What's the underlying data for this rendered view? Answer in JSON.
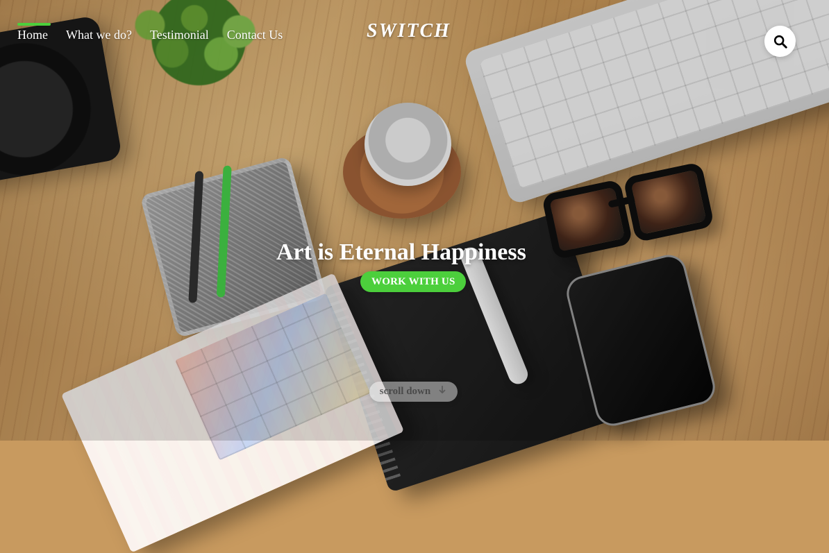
{
  "nav": {
    "items": [
      {
        "label": "Home",
        "active": true
      },
      {
        "label": "What we do?",
        "active": false
      },
      {
        "label": "Testimonial",
        "active": false
      },
      {
        "label": "Contact Us",
        "active": false
      }
    ],
    "logo_text": "SWITCH",
    "search_icon": "search-icon",
    "accent_color": "#4ccf3c"
  },
  "hero": {
    "title": "Art is Eternal Happiness",
    "cta_label": "WORK WITH US"
  },
  "scroll": {
    "label": "scroll down",
    "icon": "arrow-down-icon"
  }
}
